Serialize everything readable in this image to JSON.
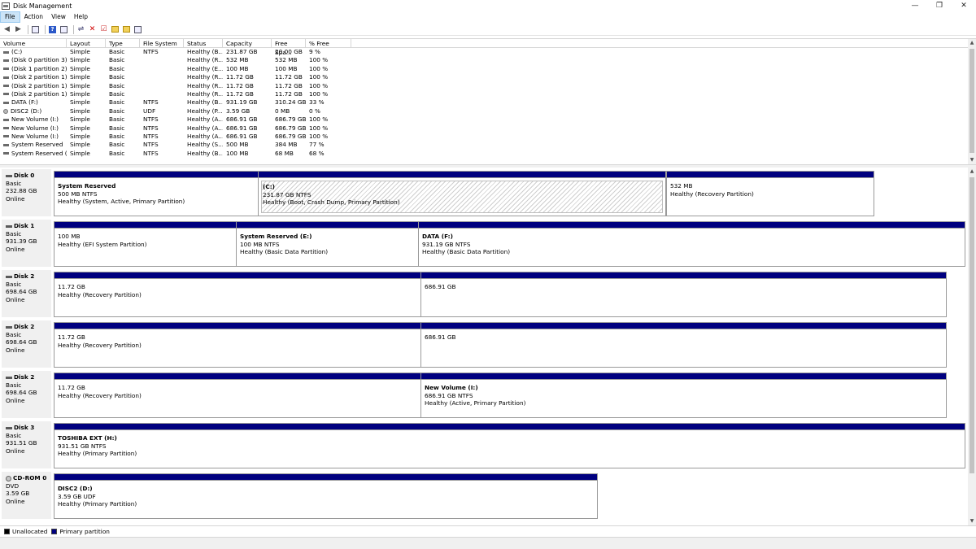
{
  "window": {
    "title": "Disk Management",
    "min_glyph": "—",
    "max_glyph": "❐",
    "close_glyph": "✕"
  },
  "menu": [
    {
      "label": "File"
    },
    {
      "label": "Action"
    },
    {
      "label": "View"
    },
    {
      "label": "Help"
    }
  ],
  "toolbar": {
    "icons": [
      "back-arrow-icon",
      "forward-arrow-icon",
      "disk-list-icon",
      "help-icon",
      "properties-icon",
      "connect-icon",
      "delete-icon",
      "checklist-icon",
      "new-folder-icon",
      "open-folder-icon",
      "settings-icon"
    ]
  },
  "volumes": {
    "headers": [
      "Volume",
      "Layout",
      "Type",
      "File System",
      "Status",
      "Capacity",
      "Free Spa...",
      "% Free"
    ],
    "rows": [
      {
        "name": "(C:)",
        "layout": "Simple",
        "type": "Basic",
        "fs": "NTFS",
        "status": "Healthy (B...",
        "capacity": "231.87 GB",
        "free": "20.00 GB",
        "pct": "9 %"
      },
      {
        "name": "(Disk 0 partition 3)",
        "layout": "Simple",
        "type": "Basic",
        "fs": "",
        "status": "Healthy (R...",
        "capacity": "532 MB",
        "free": "532 MB",
        "pct": "100 %"
      },
      {
        "name": "(Disk 1 partition 2)",
        "layout": "Simple",
        "type": "Basic",
        "fs": "",
        "status": "Healthy (E...",
        "capacity": "100 MB",
        "free": "100 MB",
        "pct": "100 %"
      },
      {
        "name": "(Disk 2 partition 1)",
        "layout": "Simple",
        "type": "Basic",
        "fs": "",
        "status": "Healthy (R...",
        "capacity": "11.72 GB",
        "free": "11.72 GB",
        "pct": "100 %"
      },
      {
        "name": "(Disk 2 partition 1)",
        "layout": "Simple",
        "type": "Basic",
        "fs": "",
        "status": "Healthy (R...",
        "capacity": "11.72 GB",
        "free": "11.72 GB",
        "pct": "100 %"
      },
      {
        "name": "(Disk 2 partition 1)",
        "layout": "Simple",
        "type": "Basic",
        "fs": "",
        "status": "Healthy (R...",
        "capacity": "11.72 GB",
        "free": "11.72 GB",
        "pct": "100 %"
      },
      {
        "name": "DATA (F:)",
        "layout": "Simple",
        "type": "Basic",
        "fs": "NTFS",
        "status": "Healthy (B...",
        "capacity": "931.19 GB",
        "free": "310.24 GB",
        "pct": "33 %"
      },
      {
        "name": "DISC2 (D:)",
        "layout": "Simple",
        "type": "Basic",
        "fs": "UDF",
        "status": "Healthy (P...",
        "capacity": "3.59 GB",
        "free": "0 MB",
        "pct": "0 %",
        "cd": true
      },
      {
        "name": "New Volume (I:)",
        "layout": "Simple",
        "type": "Basic",
        "fs": "NTFS",
        "status": "Healthy (A...",
        "capacity": "686.91 GB",
        "free": "686.79 GB",
        "pct": "100 %"
      },
      {
        "name": "New Volume (I:)",
        "layout": "Simple",
        "type": "Basic",
        "fs": "NTFS",
        "status": "Healthy (A...",
        "capacity": "686.91 GB",
        "free": "686.79 GB",
        "pct": "100 %"
      },
      {
        "name": "New Volume (I:)",
        "layout": "Simple",
        "type": "Basic",
        "fs": "NTFS",
        "status": "Healthy (A...",
        "capacity": "686.91 GB",
        "free": "686.79 GB",
        "pct": "100 %"
      },
      {
        "name": "System Reserved",
        "layout": "Simple",
        "type": "Basic",
        "fs": "NTFS",
        "status": "Healthy (S...",
        "capacity": "500 MB",
        "free": "384 MB",
        "pct": "77 %"
      },
      {
        "name": "System Reserved (...",
        "layout": "Simple",
        "type": "Basic",
        "fs": "NTFS",
        "status": "Healthy (B...",
        "capacity": "100 MB",
        "free": "68 MB",
        "pct": "68 %"
      }
    ]
  },
  "disks": [
    {
      "name": "Disk 0",
      "kind": "Basic",
      "size": "232.88 GB",
      "state": "Online",
      "icon": "disk",
      "partitions": [
        {
          "title": "System Reserved",
          "size": "500 MB NTFS",
          "status": "Healthy (System, Active, Primary Partition)"
        },
        {
          "title": "(C:)",
          "size": "231.87 GB NTFS",
          "status": "Healthy (Boot, Crash Dump, Primary Partition)",
          "hatched": true
        },
        {
          "title": "",
          "size": "532 MB",
          "status": "Healthy (Recovery Partition)"
        }
      ]
    },
    {
      "name": "Disk 1",
      "kind": "Basic",
      "size": "931.39 GB",
      "state": "Online",
      "icon": "disk",
      "partitions": [
        {
          "title": "",
          "size": "100 MB",
          "status": "Healthy (EFI System Partition)"
        },
        {
          "title": "System Reserved  (E:)",
          "size": "100 MB NTFS",
          "status": "Healthy (Basic Data Partition)"
        },
        {
          "title": "DATA  (F:)",
          "size": "931.19 GB NTFS",
          "status": "Healthy (Basic Data Partition)"
        }
      ]
    },
    {
      "name": "Disk 2",
      "kind": "Basic",
      "size": "698.64 GB",
      "state": "Online",
      "icon": "disk",
      "partitions": [
        {
          "title": "",
          "size": "11.72 GB",
          "status": "Healthy (Recovery Partition)"
        },
        {
          "title": "",
          "size": "686.91 GB",
          "status": ""
        }
      ]
    },
    {
      "name": "Disk 2",
      "kind": "Basic",
      "size": "698.64 GB",
      "state": "Online",
      "icon": "disk",
      "partitions": [
        {
          "title": "",
          "size": "11.72 GB",
          "status": "Healthy (Recovery Partition)"
        },
        {
          "title": "",
          "size": "686.91 GB",
          "status": ""
        }
      ]
    },
    {
      "name": "Disk 2",
      "kind": "Basic",
      "size": "698.64 GB",
      "state": "Online",
      "icon": "disk",
      "partitions": [
        {
          "title": "",
          "size": "11.72 GB",
          "status": "Healthy (Recovery Partition)"
        },
        {
          "title": "New Volume  (I:)",
          "size": "686.91 GB NTFS",
          "status": "Healthy (Active, Primary Partition)"
        }
      ]
    },
    {
      "name": "Disk 3",
      "kind": "Basic",
      "size": "931.51 GB",
      "state": "Online",
      "icon": "disk",
      "partitions": [
        {
          "title": "TOSHIBA EXT  (H:)",
          "size": "931.51 GB NTFS",
          "status": "Healthy (Primary Partition)"
        }
      ]
    },
    {
      "name": "CD-ROM 0",
      "kind": "DVD",
      "size": "3.59 GB",
      "state": "Online",
      "icon": "cd",
      "partitions": [
        {
          "title": "DISC2  (D:)",
          "size": "3.59 GB UDF",
          "status": "Healthy (Primary Partition)"
        }
      ]
    }
  ],
  "legend": [
    {
      "label": "Unallocated",
      "color": "#000000"
    },
    {
      "label": "Primary partition",
      "color": "#00007f"
    }
  ]
}
